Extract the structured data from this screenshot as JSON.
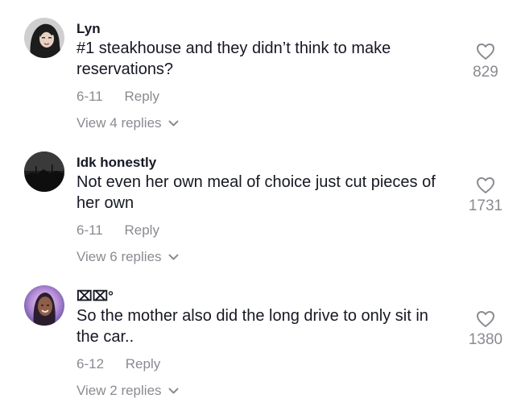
{
  "comments": [
    {
      "username": "Lyn",
      "text": "#1 steakhouse and they didn’t think to make reservations?",
      "date": "6-11",
      "reply_label": "Reply",
      "view_replies": "View 4 replies",
      "likes": "829",
      "avatar": "woman-dark-hair-avatar"
    },
    {
      "username": "Idk honestly",
      "text": "Not even her own meal of choice just cut pieces of her own",
      "date": "6-11",
      "reply_label": "Reply",
      "view_replies": "View 6 replies",
      "likes": "1731",
      "avatar": "dark-landscape-avatar"
    },
    {
      "username": "⌧⌧°",
      "text": "So the mother also did the long drive to only sit in the car..",
      "date": "6-12",
      "reply_label": "Reply",
      "view_replies": "View 2 replies",
      "likes": "1380",
      "avatar": "woman-purple-glow-avatar"
    }
  ],
  "colors": {
    "primary_text": "#161823",
    "secondary_text": "#8a8b91",
    "background": "#ffffff"
  },
  "icons": {
    "like": "heart-outline-icon",
    "expand": "chevron-down-icon"
  }
}
